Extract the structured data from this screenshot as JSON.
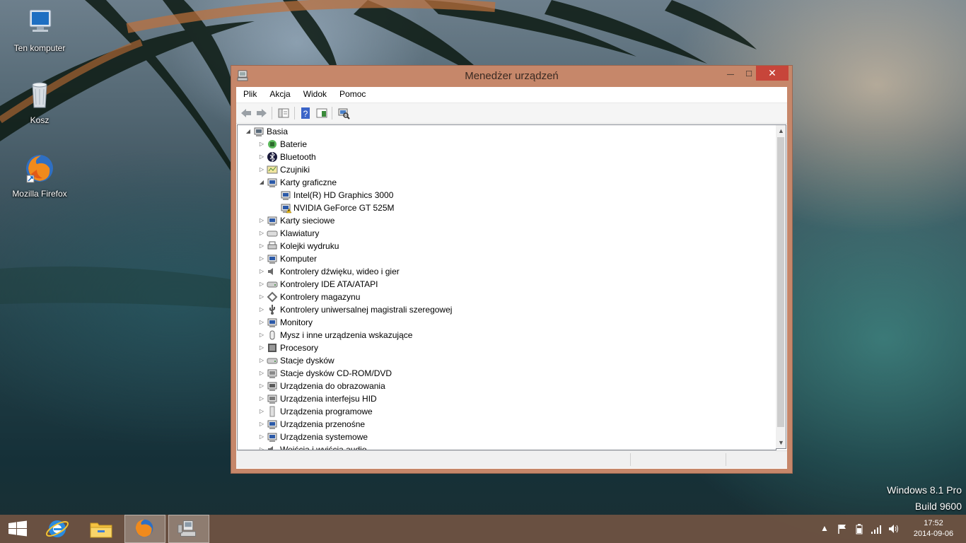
{
  "desktop": {
    "icons": [
      {
        "label": "Ten komputer",
        "icon": "computer-icon"
      },
      {
        "label": "Kosz",
        "icon": "recycle-bin-icon"
      },
      {
        "label": "Mozilla Firefox",
        "icon": "firefox-icon"
      }
    ],
    "watermark": {
      "line1": "Windows 8.1 Pro",
      "line2": "Build 9600"
    }
  },
  "window": {
    "title": "Menedżer urządzeń",
    "close_glyph": "✕",
    "max_glyph": "□",
    "min_glyph": "—",
    "menu": [
      "Plik",
      "Akcja",
      "Widok",
      "Pomoc"
    ],
    "toolbar": [
      "back-icon",
      "forward-icon",
      "properties-view-icon",
      "help-icon",
      "toggle-view-icon",
      "scan-hardware-icon"
    ],
    "tree": {
      "root": {
        "label": "Basia",
        "expanded": true
      },
      "items": [
        {
          "label": "Baterie",
          "icon": "battery-icon",
          "expanded": false
        },
        {
          "label": "Bluetooth",
          "icon": "bluetooth-icon",
          "expanded": false
        },
        {
          "label": "Czujniki",
          "icon": "sensor-icon",
          "expanded": false
        },
        {
          "label": "Karty graficzne",
          "icon": "display-adapter-icon",
          "expanded": true,
          "children": [
            {
              "label": "Intel(R) HD Graphics 3000",
              "icon": "display-adapter-icon",
              "warning": false
            },
            {
              "label": "NVIDIA GeForce GT 525M",
              "icon": "display-adapter-warning-icon",
              "warning": true
            }
          ]
        },
        {
          "label": "Karty sieciowe",
          "icon": "network-adapter-icon",
          "expanded": false
        },
        {
          "label": "Klawiatury",
          "icon": "keyboard-icon",
          "expanded": false
        },
        {
          "label": "Kolejki wydruku",
          "icon": "printer-icon",
          "expanded": false
        },
        {
          "label": "Komputer",
          "icon": "computer-icon",
          "expanded": false
        },
        {
          "label": "Kontrolery dźwięku, wideo i gier",
          "icon": "speaker-icon",
          "expanded": false
        },
        {
          "label": "Kontrolery IDE ATA/ATAPI",
          "icon": "ide-controller-icon",
          "expanded": false
        },
        {
          "label": "Kontrolery magazynu",
          "icon": "storage-controller-icon",
          "expanded": false
        },
        {
          "label": "Kontrolery uniwersalnej magistrali szeregowej",
          "icon": "usb-icon",
          "expanded": false
        },
        {
          "label": "Monitory",
          "icon": "monitor-icon",
          "expanded": false
        },
        {
          "label": "Mysz i inne urządzenia wskazujące",
          "icon": "mouse-icon",
          "expanded": false
        },
        {
          "label": "Procesory",
          "icon": "processor-icon",
          "expanded": false
        },
        {
          "label": "Stacje dysków",
          "icon": "disk-drive-icon",
          "expanded": false
        },
        {
          "label": "Stacje dysków CD-ROM/DVD",
          "icon": "cdrom-icon",
          "expanded": false
        },
        {
          "label": "Urządzenia do obrazowania",
          "icon": "imaging-icon",
          "expanded": false
        },
        {
          "label": "Urządzenia interfejsu HID",
          "icon": "hid-icon",
          "expanded": false
        },
        {
          "label": "Urządzenia programowe",
          "icon": "software-device-icon",
          "expanded": false
        },
        {
          "label": "Urządzenia przenośne",
          "icon": "portable-device-icon",
          "expanded": false
        },
        {
          "label": "Urządzenia systemowe",
          "icon": "system-device-icon",
          "expanded": false
        },
        {
          "label": "Wejścia i wyjścia audio",
          "icon": "audio-io-icon",
          "expanded": false
        }
      ]
    }
  },
  "taskbar": {
    "apps": [
      "start-icon",
      "internet-explorer-icon",
      "file-explorer-icon",
      "firefox-icon",
      "device-manager-icon"
    ],
    "clock": {
      "time": "17:52",
      "date": "2014-09-06"
    }
  },
  "colors": {
    "window_frame": "#c6876a",
    "close_button": "#c7453a",
    "taskbar": "#705442"
  }
}
